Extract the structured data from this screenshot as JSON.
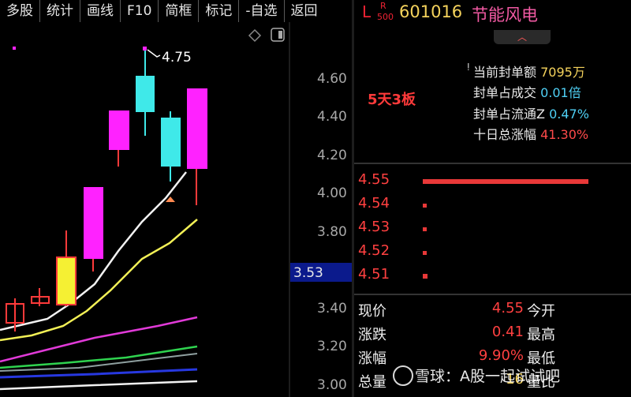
{
  "toolbar": [
    "多股",
    "统计",
    "画线",
    "F10",
    "简框",
    "标记",
    "-自选",
    "返回"
  ],
  "chart": {
    "high_label": "4.75",
    "price_ticks": [
      "4.60",
      "4.40",
      "4.20",
      "4.00",
      "3.80",
      "3.40",
      "3.20",
      "3.00"
    ],
    "current_price_tag": "3.53",
    "colors": {
      "up": "#ff22ff",
      "down": "#3fe9e9",
      "limit_up": "#f5f033",
      "axis_tag_bg": "#0b1a8c"
    }
  },
  "stock": {
    "market": "L",
    "badge_r": "R",
    "badge_500": "500",
    "code": "601016",
    "name": "节能风电"
  },
  "board_label": "5天3板",
  "stats": [
    {
      "label": "当前封单额",
      "value": "7095万",
      "color": "#f5d35c"
    },
    {
      "label": "封单占成交",
      "value": "0.01倍",
      "color": "#4fd0f5"
    },
    {
      "label": "封单占流通Z",
      "value": "0.47%",
      "color": "#4fd0f5"
    },
    {
      "label": "十日总涨幅",
      "value": "41.30%",
      "color": "#ff4a4a"
    }
  ],
  "orderbook": [
    {
      "price": "4.55",
      "level": 1.0
    },
    {
      "price": "4.54",
      "level": 0.02
    },
    {
      "price": "4.53",
      "level": 0.02
    },
    {
      "price": "4.52",
      "level": 0.02
    },
    {
      "price": "4.51",
      "level": 0.03
    }
  ],
  "quote": [
    {
      "label": "现价",
      "value": "4.55",
      "label2": "今开"
    },
    {
      "label": "涨跌",
      "value": "0.41",
      "label2": "最高"
    },
    {
      "label": "涨幅",
      "value": "9.90%",
      "label2": "最低"
    },
    {
      "label": "总量",
      "value": "16",
      "label2": "量比"
    }
  ],
  "watermark": "雪球：A股一起试试吧"
}
